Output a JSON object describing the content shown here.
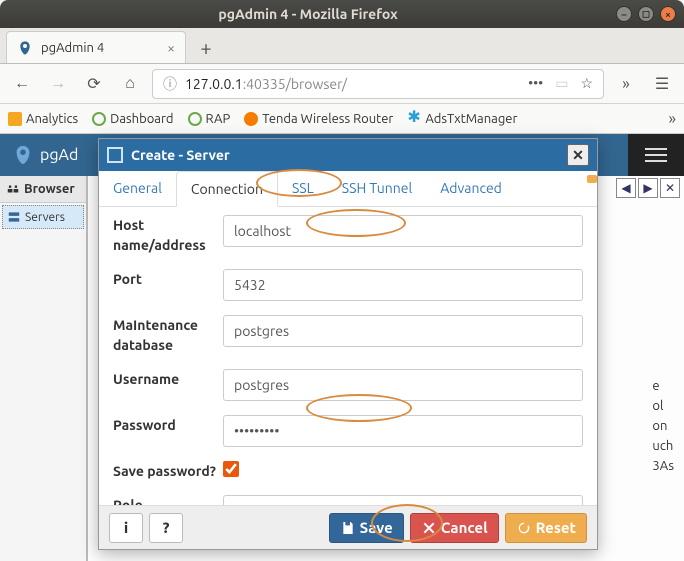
{
  "window": {
    "title": "pgAdmin 4 - Mozilla Firefox"
  },
  "browser": {
    "tab_title": "pgAdmin 4",
    "url_host": "127.0.0.1",
    "url_rest": ":40335/browser/"
  },
  "bookmarks": [
    "Analytics",
    "Dashboard",
    "RAP",
    "Tenda Wireless Router",
    "AdsTxtManager"
  ],
  "pga": {
    "appname": "pgAd",
    "side_header": "Browser",
    "tree_item": "Servers",
    "side_snippet": [
      "e",
      "ol",
      "on",
      "uch",
      "3As"
    ]
  },
  "modal": {
    "title": "Create - Server",
    "tabs": [
      "General",
      "Connection",
      "SSL",
      "SSH Tunnel",
      "Advanced"
    ],
    "active_tab": 1,
    "fields": {
      "host_label": "Host name/address",
      "host_value": "localhost",
      "port_label": "Port",
      "port_value": "5432",
      "maint_label": "MaIntenance database",
      "maint_value": "postgres",
      "user_label": "Username",
      "user_value": "postgres",
      "pass_label": "Password",
      "pass_value": "•••••••••",
      "savepw_label": "Save password?",
      "savepw_checked": true,
      "role_label": "Role",
      "role_value": ""
    },
    "buttons": {
      "save": "Save",
      "cancel": "Cancel",
      "reset": "Reset"
    }
  }
}
